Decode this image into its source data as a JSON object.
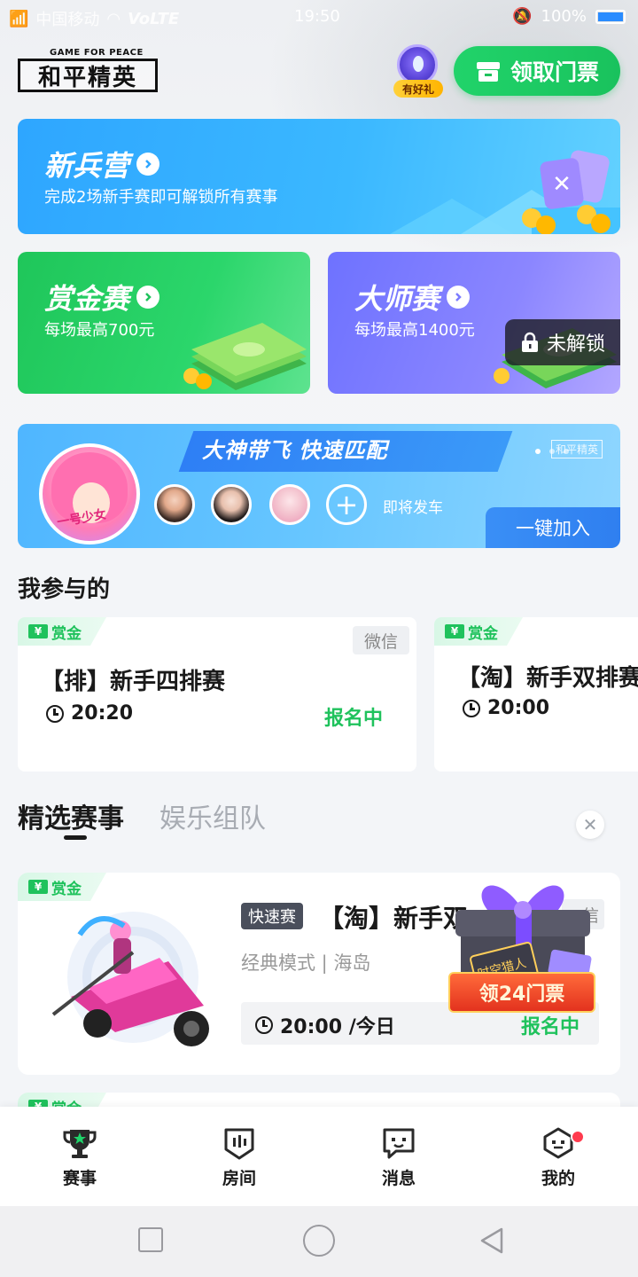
{
  "status_bar": {
    "carrier": "中国移动",
    "network": "VoLTE",
    "time": "19:50",
    "battery": "100%"
  },
  "header": {
    "logo_tag": "GAME FOR PEACE",
    "logo_name": "和平精英",
    "gift_badge_label": "有好礼",
    "ticket_button_label": "领取门票"
  },
  "recruit_card": {
    "title": "新兵营",
    "subtitle": "完成2场新手赛即可解锁所有赛事"
  },
  "bounty_card": {
    "title": "赏金赛",
    "subtitle": "每场最高700元"
  },
  "master_card": {
    "title": "大师赛",
    "subtitle": "每场最高1400元",
    "lock_label": "未解锁"
  },
  "banner": {
    "ribbon_text": "大神带飞 快速匹配",
    "brand_mini": "和平精英",
    "soon_label": "即将发车",
    "join_button_label": "一键加入",
    "avatar_caption": "一号少女"
  },
  "my_section": {
    "title": "我参与的",
    "cards": [
      {
        "tag": "赏金",
        "platform": "微信",
        "name": "【排】新手四排赛",
        "time": "20:20",
        "status": "报名中"
      },
      {
        "tag": "赏金",
        "name": "【淘】新手双排赛",
        "time": "20:00"
      }
    ]
  },
  "tabs": {
    "items": [
      "精选赛事",
      "娱乐组队"
    ]
  },
  "featured": {
    "tag": "赏金",
    "fast_tag": "快速赛",
    "name": "【淘】新手双",
    "platform": "信",
    "mode": "经典模式 | 海岛",
    "time": "20:00 /今日",
    "status": "报名中"
  },
  "promo": {
    "label": "领24门票",
    "box_text": "时空猎人"
  },
  "peek_card": {
    "tag": "赏金"
  },
  "bottom_nav": {
    "items": [
      "赛事",
      "房间",
      "消息",
      "我的"
    ]
  },
  "colors": {
    "accent_green": "#1fc25c",
    "recruit_blue": "#2ea6ff",
    "master_purple": "#7b7bff",
    "notification_red": "#ff3b4e"
  }
}
